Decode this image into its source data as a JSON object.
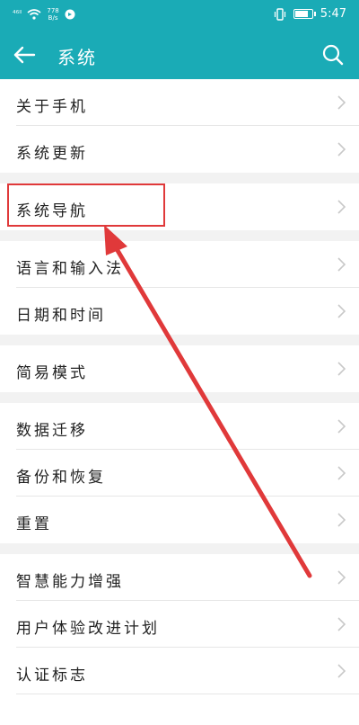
{
  "statusbar": {
    "signal": "⁴⁶ᴵˡ",
    "speed_top": "778",
    "speed_bottom": "B/s",
    "time": "5:47"
  },
  "appbar": {
    "title": "系统"
  },
  "groups": [
    {
      "items": [
        {
          "label": "关于手机"
        },
        {
          "label": "系统更新"
        }
      ]
    },
    {
      "items": [
        {
          "label": "系统导航"
        }
      ]
    },
    {
      "items": [
        {
          "label": "语言和输入法"
        },
        {
          "label": "日期和时间"
        }
      ]
    },
    {
      "items": [
        {
          "label": "简易模式"
        }
      ]
    },
    {
      "items": [
        {
          "label": "数据迁移"
        },
        {
          "label": "备份和恢复"
        },
        {
          "label": "重置"
        }
      ]
    },
    {
      "items": [
        {
          "label": "智慧能力增强"
        },
        {
          "label": "用户体验改进计划"
        },
        {
          "label": "认证标志"
        }
      ]
    }
  ],
  "colors": {
    "accent": "#1aabb6",
    "annotation": "#e0393a"
  },
  "battery_level": 0.8
}
